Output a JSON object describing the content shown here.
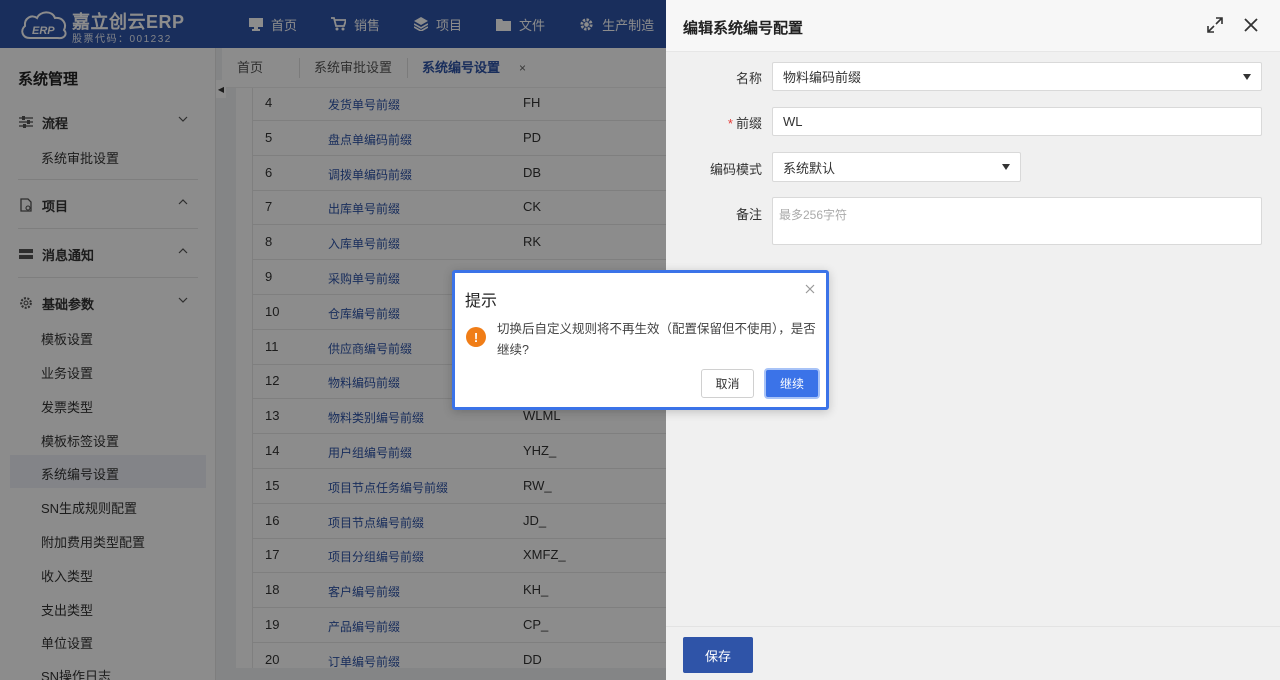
{
  "brand": {
    "name": "嘉立创云ERP",
    "stock_code": "股票代码：001232",
    "logo_text": "ERP"
  },
  "topnav": [
    {
      "label": "首页",
      "icon": "monitor-icon"
    },
    {
      "label": "销售",
      "icon": "cart-icon"
    },
    {
      "label": "项目",
      "icon": "layers-icon"
    },
    {
      "label": "文件",
      "icon": "folder-icon"
    },
    {
      "label": "生产制造",
      "icon": "gear-icon"
    }
  ],
  "sidebar": {
    "title": "系统管理",
    "groups": [
      {
        "label": "流程",
        "items": [
          "系统审批设置"
        ]
      },
      {
        "label": "项目",
        "items": []
      },
      {
        "label": "消息通知",
        "items": []
      },
      {
        "label": "基础参数",
        "items": [
          "模板设置",
          "业务设置",
          "发票类型",
          "模板标签设置",
          "系统编号设置",
          "SN生成规则配置",
          "附加费用类型配置",
          "收入类型",
          "支出类型",
          "单位设置",
          "SN操作日志"
        ]
      }
    ],
    "active_item": "系统编号设置"
  },
  "tabs": [
    {
      "label": "首页"
    },
    {
      "label": "系统审批设置"
    },
    {
      "label": "系统编号设置"
    }
  ],
  "tab_close": "×",
  "table_rows": [
    {
      "num": "4",
      "name": "发货单号前缀",
      "prefix": "FH"
    },
    {
      "num": "5",
      "name": "盘点单编码前缀",
      "prefix": "PD"
    },
    {
      "num": "6",
      "name": "调拨单编码前缀",
      "prefix": "DB"
    },
    {
      "num": "7",
      "name": "出库单号前缀",
      "prefix": "CK"
    },
    {
      "num": "8",
      "name": "入库单号前缀",
      "prefix": "RK"
    },
    {
      "num": "9",
      "name": "采购单号前缀",
      "prefix": ""
    },
    {
      "num": "10",
      "name": "仓库编号前缀",
      "prefix": ""
    },
    {
      "num": "11",
      "name": "供应商编号前缀",
      "prefix": ""
    },
    {
      "num": "12",
      "name": "物料编码前缀",
      "prefix": ""
    },
    {
      "num": "13",
      "name": "物料类别编号前缀",
      "prefix": "WLML"
    },
    {
      "num": "14",
      "name": "用户组编号前缀",
      "prefix": "YHZ_"
    },
    {
      "num": "15",
      "name": "项目节点任务编号前缀",
      "prefix": "RW_"
    },
    {
      "num": "16",
      "name": "项目节点编号前缀",
      "prefix": "JD_"
    },
    {
      "num": "17",
      "name": "项目分组编号前缀",
      "prefix": "XMFZ_"
    },
    {
      "num": "18",
      "name": "客户编号前缀",
      "prefix": "KH_"
    },
    {
      "num": "19",
      "name": "产品编号前缀",
      "prefix": "CP_"
    },
    {
      "num": "20",
      "name": "订单编号前缀",
      "prefix": "DD"
    }
  ],
  "drawer": {
    "title": "编辑系统编号配置",
    "fields": {
      "name_label": "名称",
      "name_value": "物料编码前缀",
      "prefix_label": "前缀",
      "prefix_required": "*",
      "prefix_value": "WL",
      "mode_label": "编码模式",
      "mode_value": "系统默认",
      "remark_label": "备注",
      "remark_placeholder": "最多256字符"
    },
    "save_label": "保存"
  },
  "dialog": {
    "title": "提示",
    "warn_glyph": "!",
    "message": "切换后自定义规则将不再生效（配置保留但不使用），是否继续?",
    "cancel_label": "取消",
    "ok_label": "继续"
  },
  "colors": {
    "brand": "#2f54a8",
    "link": "#2f54a8",
    "warning": "#f07d17",
    "primary": "#3b73e8"
  }
}
